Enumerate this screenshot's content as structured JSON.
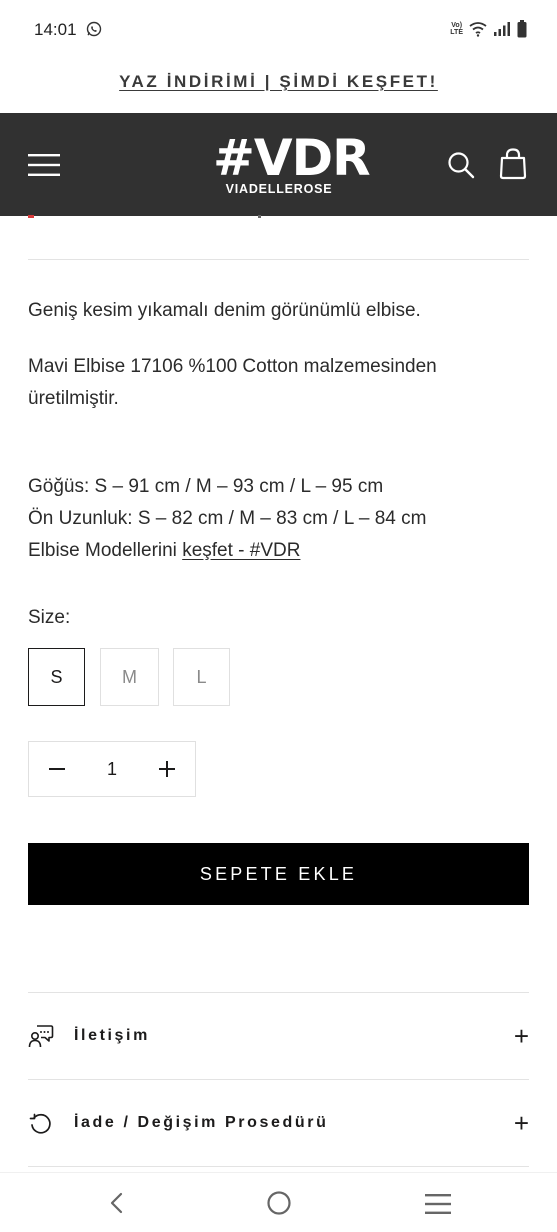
{
  "status_bar": {
    "time": "14:01",
    "volte_top": "Vo)",
    "volte_bottom": "LTE"
  },
  "promo": {
    "text": "YAZ İNDİRİMİ | ŞİMDİ KEŞFET!"
  },
  "header": {
    "logo_main": "#VDR",
    "logo_sub": "VIADELLEROSE"
  },
  "product": {
    "description": "Geniş kesim yıkamalı denim görünümlü elbise.",
    "material": "Mavi Elbise 17106 %100 Cotton malzemesinden üretilmiştir.",
    "chest": "Göğüs: S – 91 cm / M – 93 cm / L – 95 cm",
    "front_length": "Ön Uzunluk: S – 82 cm / M – 83 cm / L – 84 cm",
    "models_prefix": "Elbise Modellerini ",
    "models_link": "keşfet - #VDR"
  },
  "size": {
    "label": "Size:",
    "options": [
      "S",
      "M",
      "L"
    ],
    "selected": "S"
  },
  "quantity": {
    "minus": "−",
    "value": "1",
    "plus": "+"
  },
  "cart": {
    "button_label": "SEPETE EKLE"
  },
  "accordion": [
    {
      "label": "İletişim",
      "icon": "chat-bubbles-icon",
      "toggle": "+"
    },
    {
      "label": "İade / Değişim Prosedürü",
      "icon": "return-arrow-icon",
      "toggle": "+"
    }
  ],
  "colors": {
    "header_bg": "#313131",
    "button_bg": "#000000",
    "text": "#1c1b1b",
    "divider": "#e3e3e3",
    "sale_red": "#d83a3a"
  }
}
